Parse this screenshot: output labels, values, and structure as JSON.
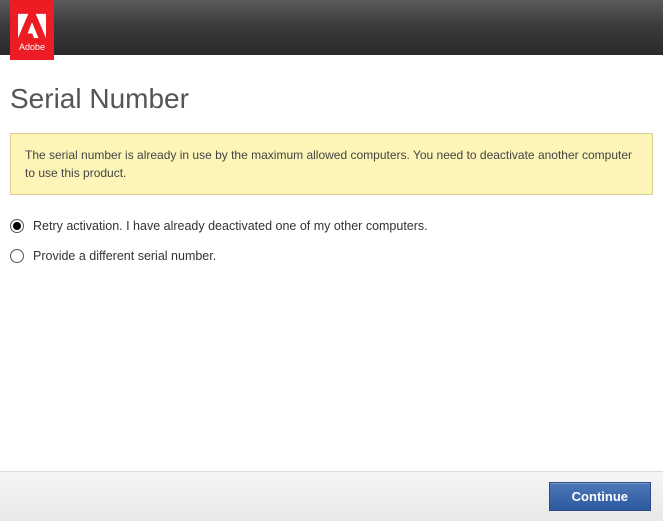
{
  "brand": {
    "name": "Adobe"
  },
  "page": {
    "title": "Serial Number"
  },
  "warning": {
    "message": "The serial number is already in use by the maximum allowed computers. You need to deactivate another computer to use this product."
  },
  "options": {
    "retry": {
      "label": "Retry activation. I have already deactivated one of my other computers.",
      "selected": true
    },
    "provide": {
      "label": "Provide a different serial number.",
      "selected": false
    }
  },
  "footer": {
    "continue_label": "Continue"
  }
}
